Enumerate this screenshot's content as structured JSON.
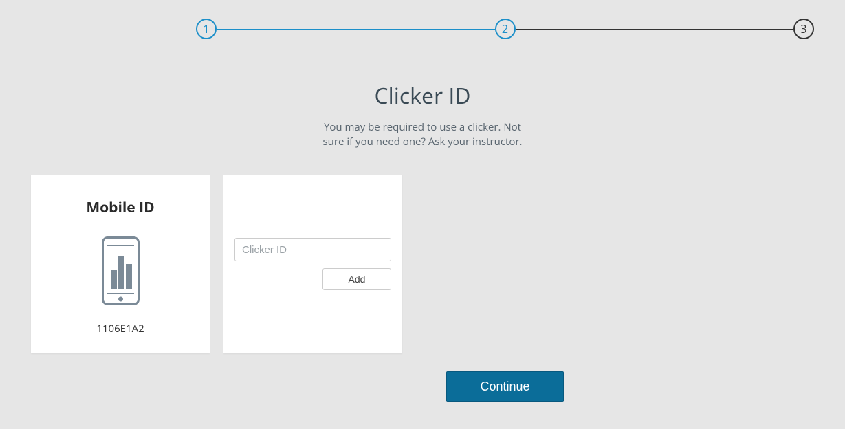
{
  "stepper": {
    "steps": [
      "1",
      "2",
      "3"
    ],
    "current_index": 1
  },
  "header": {
    "title": "Clicker ID",
    "subtitle": "You may be required to use a clicker. Not sure if you need one? Ask your instructor."
  },
  "mobile_card": {
    "title": "Mobile ID",
    "value": "1106E1A2"
  },
  "clicker_card": {
    "input_placeholder": "Clicker ID",
    "input_value": "",
    "add_label": "Add"
  },
  "actions": {
    "continue_label": "Continue"
  },
  "colors": {
    "accent": "#1c8fc9",
    "primary_button": "#0b6d99"
  }
}
